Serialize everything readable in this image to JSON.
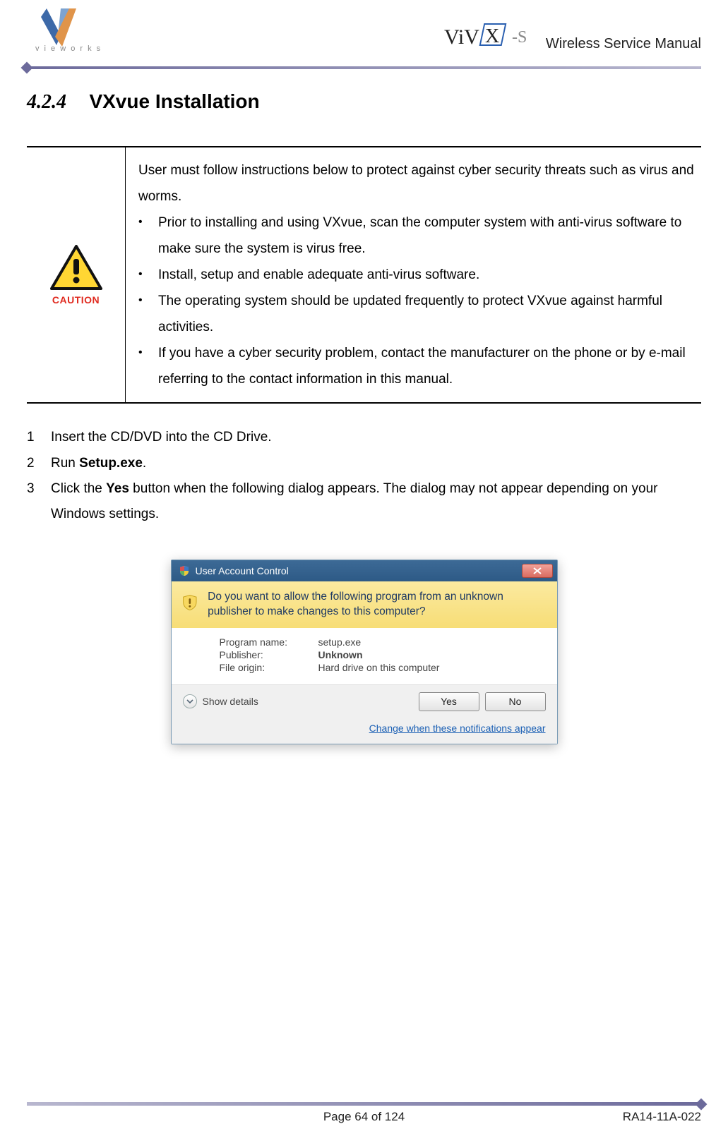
{
  "header": {
    "logo_left_letters": "v i e w o r k s",
    "doc_title": "Wireless Service Manual",
    "product_logo_text_a": "ViV",
    "product_logo_text_b": "X",
    "product_logo_suffix": "-S"
  },
  "section": {
    "number": "4.2.4",
    "title": "VXvue Installation"
  },
  "caution": {
    "label": "CAUTION",
    "intro": "User must follow instructions below to protect against cyber security threats such as virus and worms.",
    "bullets": [
      "Prior to installing and using VXvue, scan the computer system with anti-virus software to make sure the system is virus free.",
      "Install, setup and enable adequate anti-virus software.",
      "The operating system should be updated frequently to protect VXvue against harmful activities.",
      "If you have a cyber security problem, contact the manufacturer on the phone or by e-mail referring to the contact information in this manual."
    ]
  },
  "steps": [
    {
      "pre": "Insert the CD/DVD into the CD Drive.",
      "bold": "",
      "post": ""
    },
    {
      "pre": "Run ",
      "bold": "Setup.exe",
      "post": "."
    },
    {
      "pre": "Click the ",
      "bold": "Yes",
      "post": " button when the following dialog appears. The dialog may not appear depending on your Windows settings."
    }
  ],
  "uac": {
    "title": "User Account Control",
    "banner": "Do you want to allow the following program from an unknown publisher to make changes to this computer?",
    "rows": {
      "program_label": "Program name:",
      "program_value": "setup.exe",
      "publisher_label": "Publisher:",
      "publisher_value": "Unknown",
      "origin_label": "File origin:",
      "origin_value": "Hard drive on this computer"
    },
    "details": "Show details",
    "yes": "Yes",
    "no": "No",
    "link": "Change when these notifications appear"
  },
  "footer": {
    "page": "Page 64 of 124",
    "doc_id": "RA14-11A-022"
  }
}
